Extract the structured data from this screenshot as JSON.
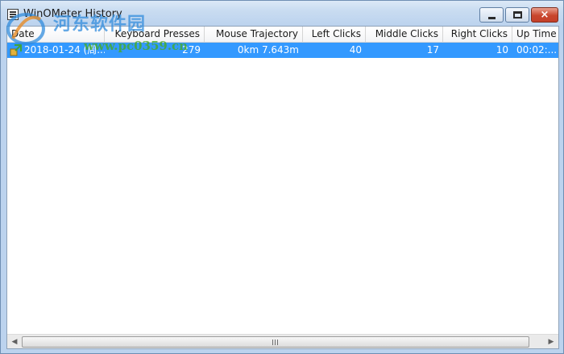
{
  "window": {
    "title": "WinOMeter History",
    "icon": "app-icon",
    "buttons": {
      "minimize": "minimize-icon",
      "maximize": "maximize-icon",
      "close_glyph": "×"
    }
  },
  "watermark": {
    "text": "河东软件园",
    "url": "www.pc0359.cn"
  },
  "table": {
    "columns": [
      {
        "label": "Date"
      },
      {
        "label": "Keyboard Presses"
      },
      {
        "label": "Mouse Trajectory"
      },
      {
        "label": "Left Clicks"
      },
      {
        "label": "Middle Clicks"
      },
      {
        "label": "Right Clicks"
      },
      {
        "label": "Up Time"
      }
    ],
    "rows": [
      {
        "selected": true,
        "icon": "history-entry-icon",
        "cells": [
          "2018-01-24 (周...",
          "279",
          "0km 7.643m",
          "40",
          "17",
          "10",
          "00:02:..."
        ]
      }
    ]
  },
  "scrollbar": {
    "left_arrow": "◀",
    "right_arrow": "▶"
  },
  "colors": {
    "selection": "#3399ff",
    "close_button": "#c8452c"
  }
}
